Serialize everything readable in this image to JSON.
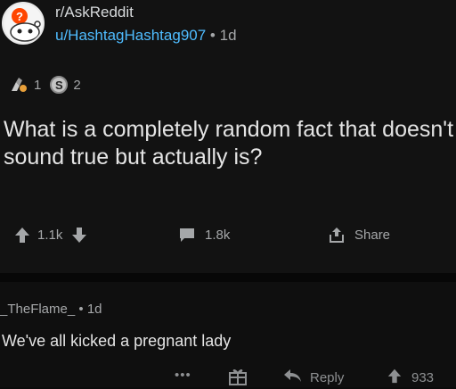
{
  "post": {
    "subreddit": "r/AskReddit",
    "author": "u/HashtagHashtag907",
    "separator": "•",
    "age": "1d",
    "awards": {
      "helpful_count": "1",
      "silver_letter": "S",
      "silver_count": "2"
    },
    "title": "What is a completely random fact that doesn't sound true but actually is?",
    "votes": "1.1k",
    "comments": "1.8k",
    "share_label": "Share"
  },
  "comment": {
    "author": "_TheFlame_",
    "separator": "•",
    "age": "1d",
    "body": "We've all kicked a pregnant lady",
    "more": "•••",
    "reply_label": "Reply",
    "score": "933"
  },
  "colors": {
    "background": "#121212",
    "author_link": "#4fbcff",
    "muted": "#a5a7a9",
    "text": "#e4e4e4"
  },
  "icons": {
    "avatar": "askreddit-avatar-icon",
    "helpful": "helpful-award-icon",
    "silver": "silver-award-icon",
    "upvote": "upvote-arrow-icon",
    "downvote": "downvote-arrow-icon",
    "comment": "comment-bubble-icon",
    "share": "share-icon",
    "gift": "gift-icon",
    "reply": "reply-arrow-icon"
  }
}
